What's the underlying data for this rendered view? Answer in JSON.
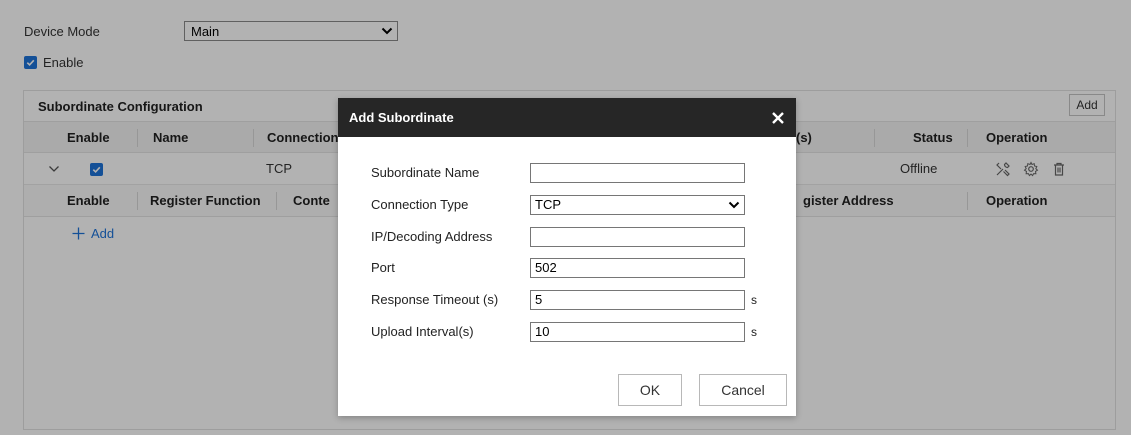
{
  "device_mode": {
    "label": "Device Mode",
    "value": "Main"
  },
  "enable": {
    "label": "Enable",
    "checked": true
  },
  "panel": {
    "title": "Subordinate Configuration",
    "add_label": "Add",
    "columns": [
      "Enable",
      "Name",
      "Connection",
      "(s)",
      "Status",
      "Operation"
    ],
    "row": {
      "connection": "TCP",
      "status": "Offline"
    },
    "sub_columns": [
      "Enable",
      "Register Function",
      "Conte",
      "gister Address",
      "Operation"
    ],
    "sub_add_label": "Add"
  },
  "dialog": {
    "title": "Add Subordinate",
    "fields": {
      "name": {
        "label": "Subordinate Name",
        "value": ""
      },
      "conn_type": {
        "label": "Connection Type",
        "value": "TCP"
      },
      "ip": {
        "label": "IP/Decoding Address",
        "value": ""
      },
      "port": {
        "label": "Port",
        "value": "502"
      },
      "timeout": {
        "label": "Response Timeout (s)",
        "value": "5",
        "unit": "s"
      },
      "interval": {
        "label": "Upload Interval(s)",
        "value": "10",
        "unit": "s"
      }
    },
    "ok_label": "OK",
    "cancel_label": "Cancel"
  },
  "colors": {
    "accent": "#1e73d9",
    "dialog_header": "#262626"
  }
}
